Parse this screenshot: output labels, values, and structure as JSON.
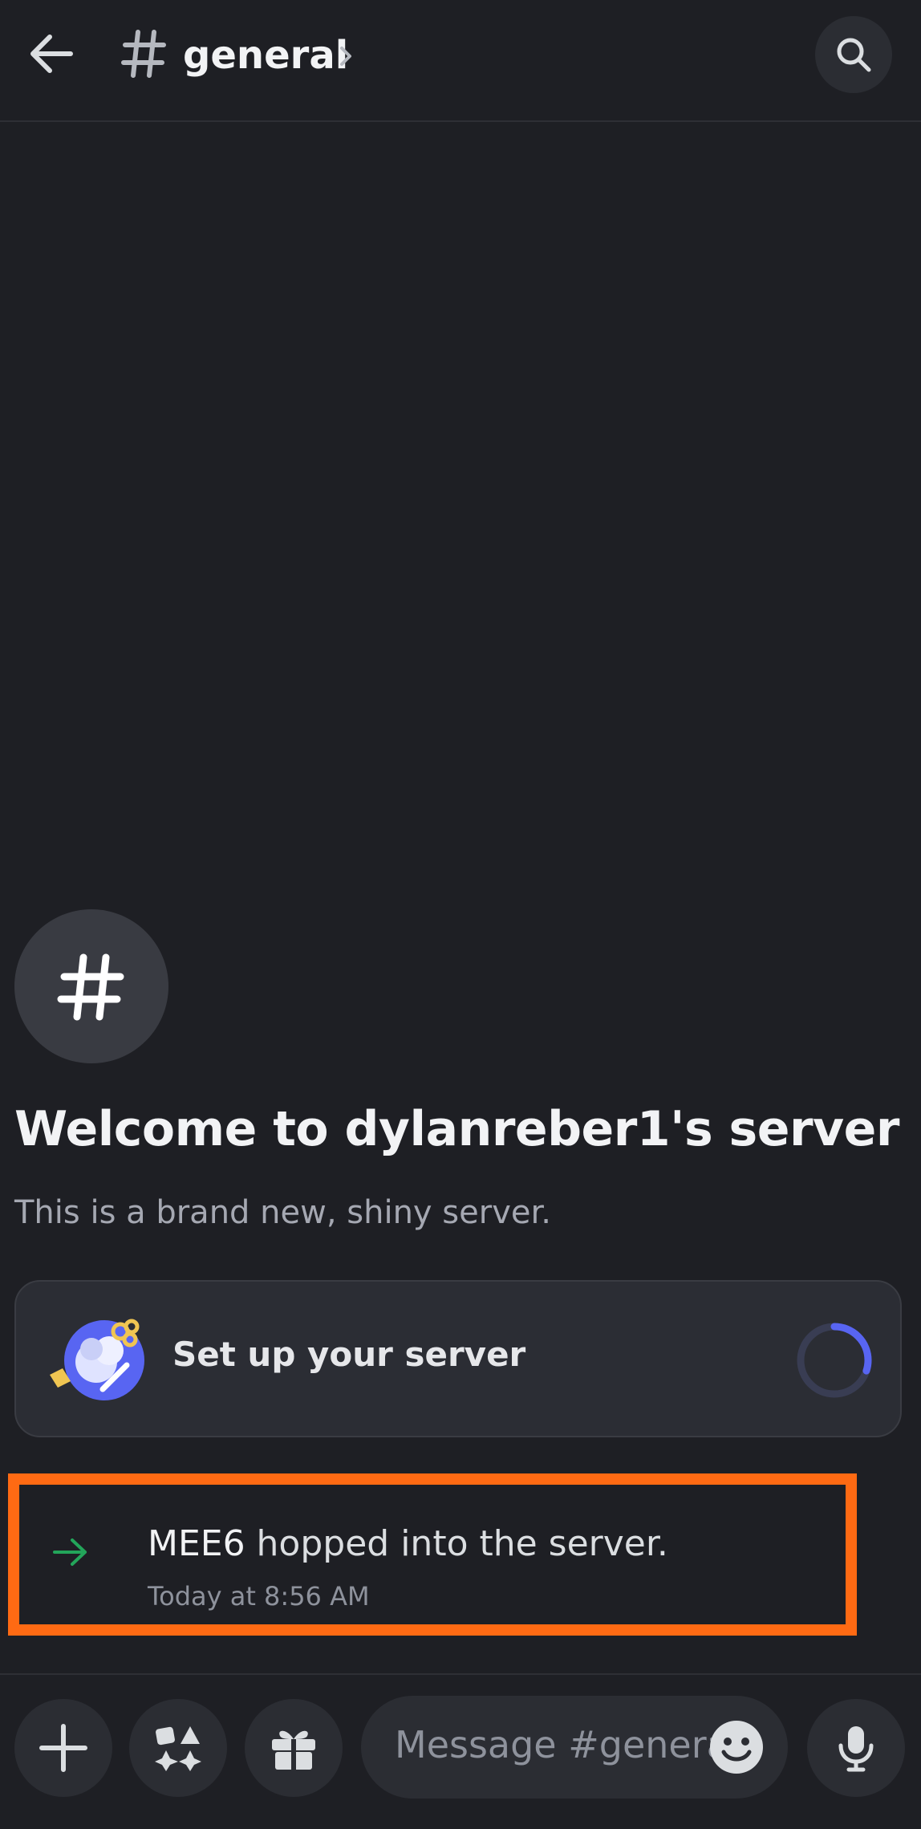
{
  "header": {
    "channel_name": "general",
    "icons": [
      "back-arrow-icon",
      "hash-icon",
      "chevron-right-icon",
      "search-icon"
    ]
  },
  "welcome": {
    "title": "Welcome to dylanreber1's server",
    "subtitle": "This is a brand new, shiny server."
  },
  "setup_card": {
    "label": "Set up your server",
    "progress": 0.3
  },
  "system_message": {
    "username": "MEE6",
    "text": " hopped into the server.",
    "timestamp": "Today at 8:56 AM"
  },
  "composer": {
    "placeholder": "Message #general",
    "buttons": [
      "plus-icon",
      "apps-icon",
      "gift-icon",
      "emoji-icon",
      "microphone-icon"
    ]
  },
  "colors": {
    "background": "#1e1f24",
    "accent": "#5865f2",
    "join_green": "#23a55a",
    "highlight_box": "#ff6a13"
  }
}
